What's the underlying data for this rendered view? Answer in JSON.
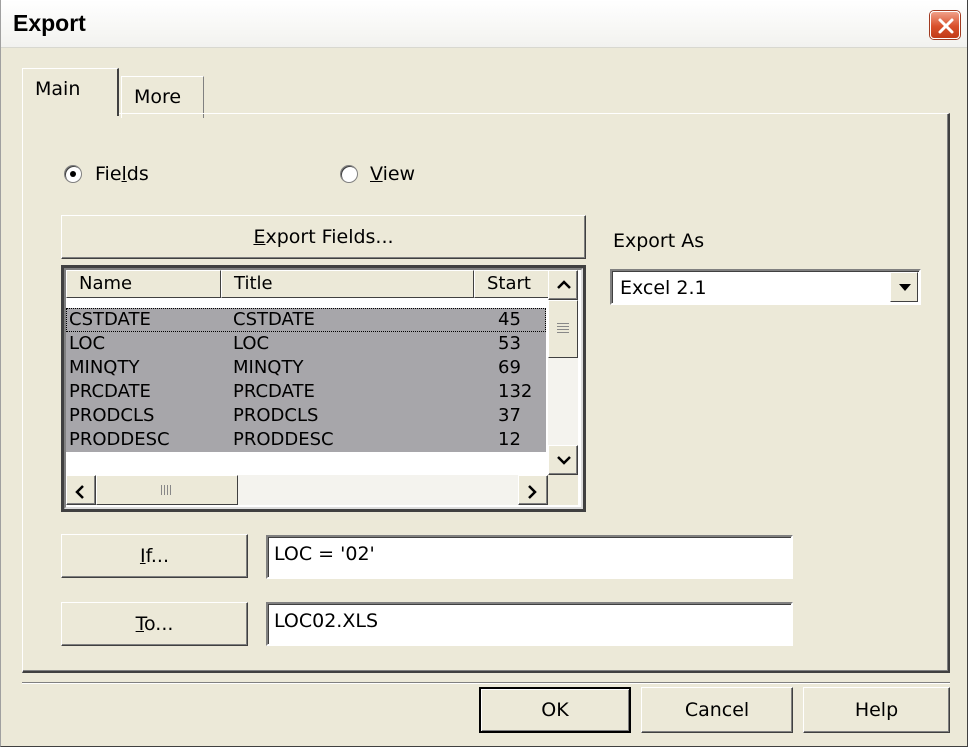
{
  "window": {
    "title": "Export"
  },
  "tabs": [
    {
      "label": "Main",
      "active": true
    },
    {
      "label": "More",
      "active": false
    }
  ],
  "radios": {
    "fields": {
      "pre": "Fie",
      "mnemonic": "l",
      "post": "ds",
      "selected": true
    },
    "view": {
      "pre": "",
      "mnemonic": "V",
      "post": "iew",
      "selected": false
    }
  },
  "export_fields_button": {
    "mnemonic": "E",
    "post": "xport Fields..."
  },
  "export_as": {
    "label": "Export As",
    "selected": "Excel 2.1"
  },
  "fields_list": {
    "columns": [
      "Name",
      "Title",
      "Start"
    ],
    "rows": [
      {
        "name": "CSTDATE",
        "title": "CSTDATE",
        "start": "45"
      },
      {
        "name": "LOC",
        "title": "LOC",
        "start": "53"
      },
      {
        "name": "MINQTY",
        "title": "MINQTY",
        "start": "69"
      },
      {
        "name": "PRCDATE",
        "title": "PRCDATE",
        "start": "132"
      },
      {
        "name": "PRODCLS",
        "title": "PRODCLS",
        "start": "37"
      },
      {
        "name": "PRODDESC",
        "title": "PRODDESC",
        "start": "12"
      }
    ]
  },
  "if_button": {
    "mnemonic": "I",
    "post": "f..."
  },
  "if_value": "LOC = '02'",
  "to_button": {
    "mnemonic": "T",
    "post": "o..."
  },
  "to_value": "LOC02.XLS",
  "footer": {
    "ok": "OK",
    "cancel": "Cancel",
    "help": "Help"
  },
  "colors": {
    "dialog_bg": "#ece9d8",
    "selection_bg": "#a7a6aa",
    "close_red": "#d9512c"
  },
  "icons": [
    "close-icon",
    "dropdown-arrow-icon",
    "scroll-up-icon",
    "scroll-down-icon",
    "scroll-left-icon",
    "scroll-right-icon"
  ]
}
